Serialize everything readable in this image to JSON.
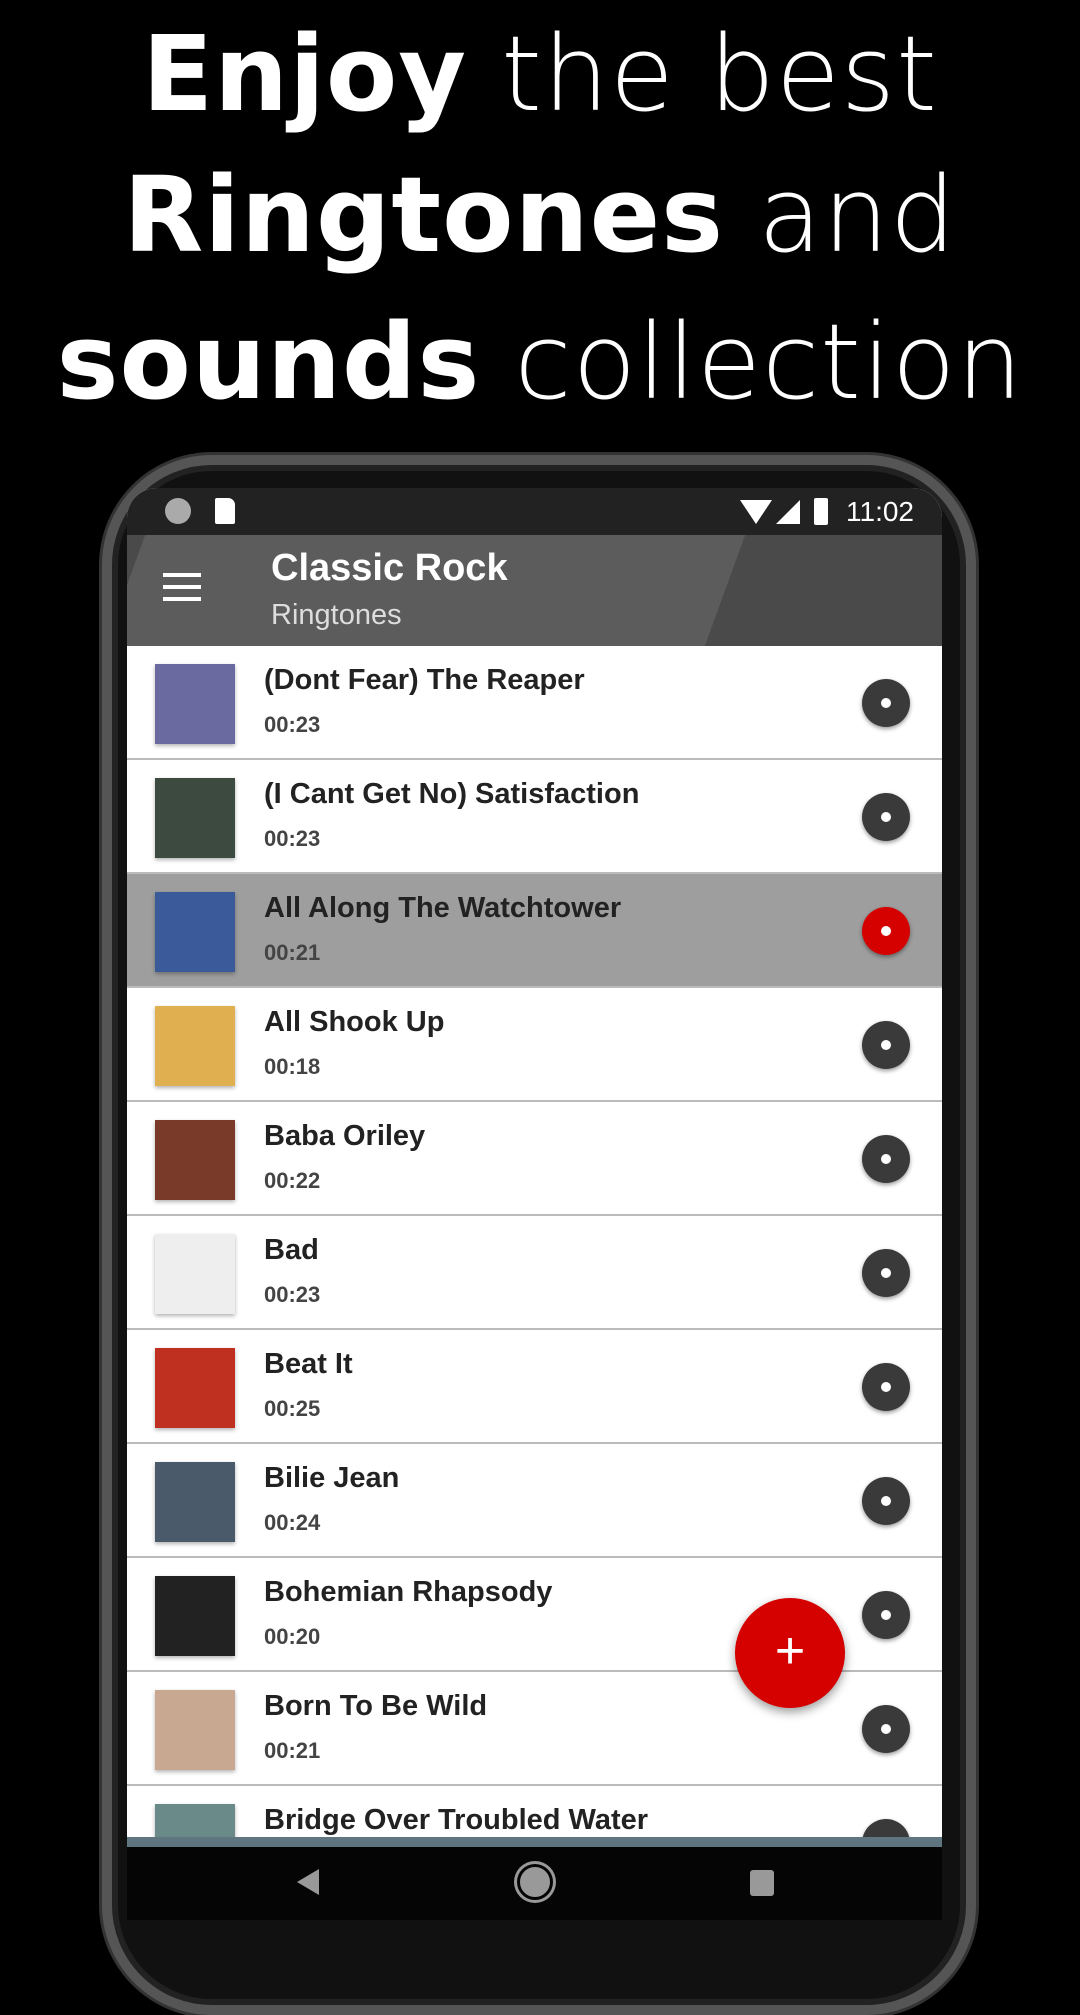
{
  "headline": {
    "l1a": "Enjoy",
    "l1b": "the best",
    "l2a": "Ringtones",
    "l2b": "and",
    "l3a": "sounds",
    "l3b": "collection"
  },
  "status": {
    "time": "11:02",
    "icons": [
      "sync-icon",
      "sd-card-icon",
      "wifi-icon",
      "signal-icon",
      "battery-icon"
    ]
  },
  "toolbar": {
    "title": "Classic Rock",
    "subtitle": "Ringtones",
    "menu_icon": "hamburger-menu-icon"
  },
  "accent": "#d50000",
  "items": [
    {
      "title": "(Dont Fear) The Reaper",
      "duration": "00:23",
      "thumb": "#6a6aa0"
    },
    {
      "title": "(I Cant Get No) Satisfaction",
      "duration": "00:23",
      "thumb": "#3d4a40"
    },
    {
      "title": "All Along The Watchtower",
      "duration": "00:21",
      "thumb": "#3a5a9a",
      "selected": true
    },
    {
      "title": "All Shook Up",
      "duration": "00:18",
      "thumb": "#e0b050"
    },
    {
      "title": "Baba Oriley",
      "duration": "00:22",
      "thumb": "#7a3a2a"
    },
    {
      "title": "Bad",
      "duration": "00:23",
      "thumb": "#eeeeee"
    },
    {
      "title": "Beat It",
      "duration": "00:25",
      "thumb": "#c03020"
    },
    {
      "title": "Bilie Jean",
      "duration": "00:24",
      "thumb": "#4a5a6a"
    },
    {
      "title": "Bohemian Rhapsody",
      "duration": "00:20",
      "thumb": "#222222"
    },
    {
      "title": "Born To Be Wild",
      "duration": "00:21",
      "thumb": "#c8a890"
    },
    {
      "title": "Bridge Over Troubled Water",
      "duration": "",
      "thumb": "#6a8a8a"
    }
  ],
  "fab": {
    "label": "+"
  }
}
